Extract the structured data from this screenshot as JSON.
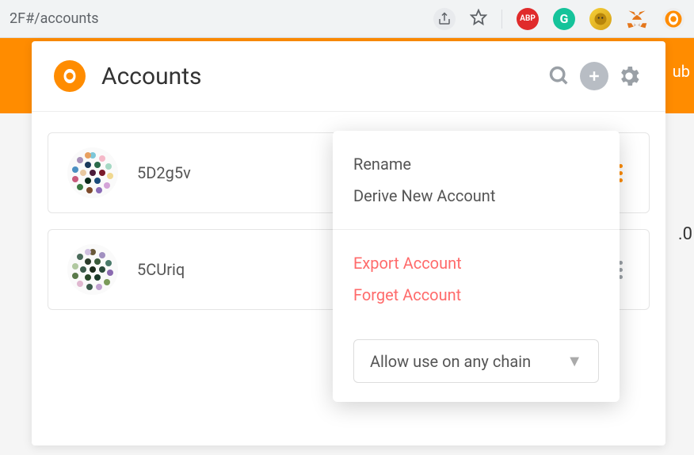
{
  "url_fragment": "2F#/accounts",
  "orange_band_stub": "ub",
  "balance_stub": ".0",
  "header": {
    "title": "Accounts"
  },
  "accounts": [
    {
      "name": "5D2g5v"
    },
    {
      "name": "5CUriq"
    }
  ],
  "context_menu": {
    "rename": "Rename",
    "derive": "Derive New Account",
    "export": "Export Account",
    "forget": "Forget Account",
    "chain_select": "Allow use on any chain"
  },
  "browser_extensions": {
    "abp": "ABP",
    "grammarly": "G"
  }
}
